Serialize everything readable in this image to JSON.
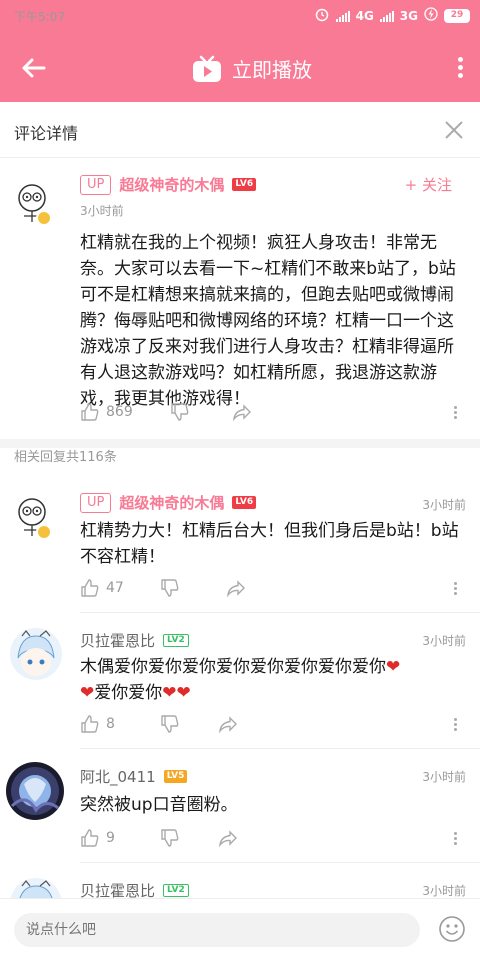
{
  "status": {
    "time": "下午5:07",
    "net1": "4G",
    "net2": "3G",
    "battery": "29"
  },
  "appbar": {
    "title": "立即播放"
  },
  "header": {
    "title": "评论详情"
  },
  "main_comment": {
    "up_tag": "UP",
    "user": "超级神奇的木偶",
    "level": "LV6",
    "follow": "+ 关注",
    "time": "3小时前",
    "text": "杠精就在我的上个视频！疯狂人身攻击！非常无奈。大家可以去看一下~杠精们不敢来b站了，b站可不是杠精想来搞就来搞的，但跑去贴吧或微博闹腾？侮辱贴吧和微博网络的环境？杠精一口一个这游戏凉了反来对我们进行人身攻击？杠精非得逼所有人退这款游戏吗？如杠精所愿，我退游这款游戏，我更其他游戏得！",
    "likes": "869"
  },
  "reply_count": "相关回复共116条",
  "replies": [
    {
      "up_tag": "UP",
      "user": "超级神奇的木偶",
      "level": "LV6",
      "time": "3小时前",
      "text": "杠精势力大！杠精后台大！但我们身后是b站！b站不容杠精！",
      "likes": "47"
    },
    {
      "user": "贝拉霍恩比",
      "level": "LV2",
      "time": "3小时前",
      "text_a": "木偶爱你爱你爱你爱你爱你爱你爱你爱你",
      "text_b": "爱你爱你",
      "likes": "8"
    },
    {
      "user": "阿北_0411",
      "level": "LV5",
      "time": "3小时前",
      "text": "突然被up口音圈粉。",
      "likes": "9"
    },
    {
      "user": "贝拉霍恩比",
      "level": "LV2",
      "time": "3小时前"
    }
  ],
  "input": {
    "placeholder": "说点什么吧"
  },
  "colors": {
    "accent": "#f97a94",
    "level_red": "#ef3d45",
    "level_green": "#3bbf66",
    "level_orange": "#f5a623"
  }
}
